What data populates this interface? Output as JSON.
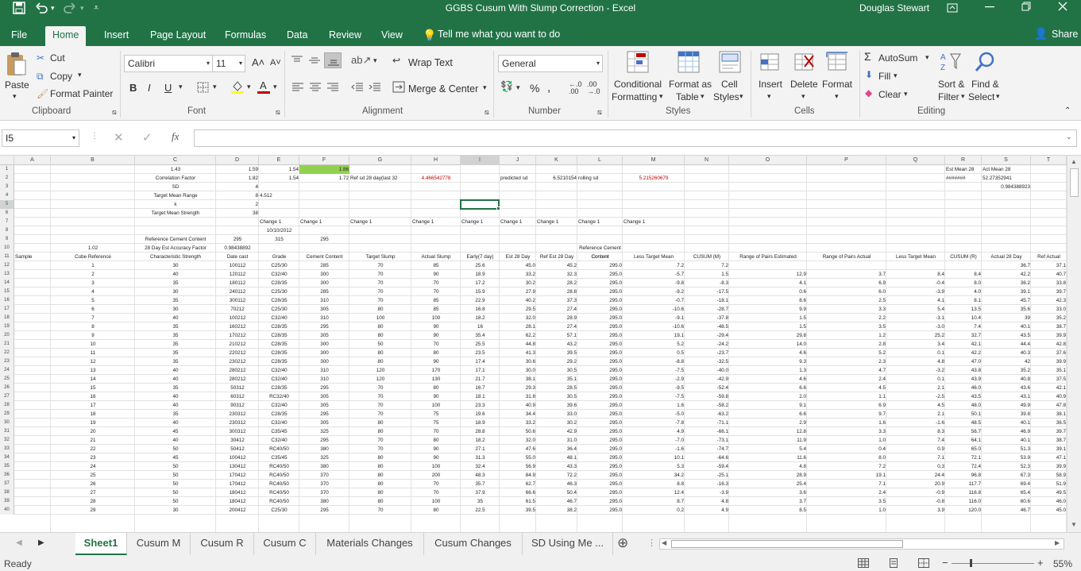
{
  "window": {
    "title": "GGBS Cusum With Slump Correction  -  Excel",
    "user": "Douglas Stewart"
  },
  "colors": {
    "brand": "#217346",
    "selected_fill": "#92d050",
    "red_text": "#c00000"
  },
  "ribbon_tabs": [
    "File",
    "Home",
    "Insert",
    "Page Layout",
    "Formulas",
    "Data",
    "Review",
    "View"
  ],
  "tell_me": "Tell me what you want to do",
  "share": "Share",
  "clipboard": {
    "paste": "Paste",
    "cut": "Cut",
    "copy": "Copy",
    "format_painter": "Format Painter",
    "label": "Clipboard"
  },
  "font": {
    "name": "Calibri",
    "size": "11",
    "label": "Font",
    "bold": "B",
    "italic": "I",
    "underline": "U"
  },
  "alignment": {
    "wrap": "Wrap Text",
    "merge": "Merge & Center",
    "label": "Alignment"
  },
  "number": {
    "format": "General",
    "label": "Number",
    "pct": "%"
  },
  "styles": {
    "cond1": "Conditional",
    "cond2": "Formatting",
    "fmt1": "Format as",
    "fmt2": "Table",
    "cell1": "Cell",
    "cell2": "Styles",
    "label": "Styles"
  },
  "cells": {
    "insert": "Insert",
    "delete": "Delete",
    "format": "Format",
    "label": "Cells"
  },
  "editing": {
    "autosum": "AutoSum",
    "fill": "Fill",
    "clear": "Clear",
    "sort1": "Sort &",
    "sort2": "Filter",
    "find1": "Find &",
    "find2": "Select",
    "label": "Editing"
  },
  "formula_bar": {
    "name_box": "I5",
    "fx": "fx",
    "value": ""
  },
  "columns": [
    "A",
    "B",
    "C",
    "D",
    "E",
    "F",
    "G",
    "H",
    "I",
    "J",
    "K",
    "L",
    "M",
    "N",
    "O",
    "P",
    "Q",
    "R",
    "S",
    "T"
  ],
  "top_rows": [
    {
      "n": "1",
      "cells": {
        "C": "1.43",
        "D": "1.59",
        "E": "1.54",
        "F": "1.86",
        "R": "Est Mean 28",
        "S": "Act Mean 28"
      }
    },
    {
      "n": "2",
      "cells": {
        "C": "Correlation Factor",
        "D": "1.82",
        "E": "1.54",
        "F": "1.72",
        "G": "Ref sd 28 day(last 32",
        "H": "4.466542778",
        "J": "predicted sd",
        "K": "6.5210154",
        "L": "rolling sd",
        "M": "5.215260679",
        "R": "#######",
        "S": "52.27352941"
      }
    },
    {
      "n": "3",
      "cells": {
        "C": "SD",
        "D": "4",
        "S": "0.984388923"
      }
    },
    {
      "n": "4",
      "cells": {
        "C": "Target Mean Range",
        "D": "8",
        "E": "4.512"
      }
    },
    {
      "n": "5",
      "cells": {
        "C": "k",
        "D": "2"
      }
    },
    {
      "n": "6",
      "cells": {
        "C": "Target Mean Strength",
        "D": "38"
      }
    },
    {
      "n": "7",
      "cells": {
        "E": "Change 1",
        "F": "Change 1",
        "G": "Change 1",
        "H": "Change 1",
        "I": "Change 1",
        "J": "Change 1",
        "K": "Change 1",
        "L": "Change 1",
        "M": "Change 1"
      }
    },
    {
      "n": "8",
      "cells": {
        "E": "10/10/2012"
      }
    },
    {
      "n": "9",
      "cells": {
        "C": "Reference Cement Content",
        "D": "295",
        "E": "315",
        "F": "295"
      }
    },
    {
      "n": "10",
      "cells": {
        "B": "1.02",
        "C": "28 Day Est Accuracy Factor",
        "D": "0.98438892",
        "L": "Reference Cement Content"
      }
    },
    {
      "n": "11",
      "cells": {
        "A": "Sample",
        "B": "Cube Reference",
        "C": "Characteristic Strength",
        "D": "Date cast",
        "E": "Grade",
        "F": "Cement Content",
        "G": "Target Slump",
        "H": "Actual Slump",
        "I": "Early(7 day)",
        "J": "Est 28 Day",
        "K": "Ref Est 28 Day",
        "L": "Content",
        "M": "Less Target Mean",
        "N": "CUSUM (M)",
        "O": "Range of Pairs Estimated",
        "P": "Range of Pairs Actual",
        "Q": "Less Target Mean",
        "R": "CUSUM (R)",
        "S": "Actual 28 Day",
        "T": "Ref Actual"
      }
    }
  ],
  "data_rows": [
    [
      "12",
      "1",
      "30",
      "100112",
      "C25/30",
      "285",
      "70",
      "85",
      "25.6",
      "45.0",
      "45.2",
      "295.0",
      "7.2",
      "7.2",
      "",
      "",
      "",
      "",
      "36.7",
      "37.1"
    ],
    [
      "13",
      "2",
      "40",
      "120112",
      "C32/40",
      "300",
      "70",
      "90",
      "18.9",
      "33.2",
      "32.3",
      "295.0",
      "-5.7",
      "1.5",
      "12.9",
      "3.7",
      "8.4",
      "8.4",
      "42.2",
      "40.7"
    ],
    [
      "14",
      "3",
      "35",
      "180112",
      "C28/35",
      "300",
      "70",
      "70",
      "17.2",
      "30.2",
      "28.2",
      "295.0",
      "-9.8",
      "-8.3",
      "4.1",
      "6.9",
      "-0.4",
      "8.0",
      "36.2",
      "33.8"
    ],
    [
      "15",
      "4",
      "30",
      "240112",
      "C25/30",
      "285",
      "70",
      "70",
      "15.9",
      "27.9",
      "28.8",
      "295.0",
      "-9.2",
      "-17.5",
      "0.6",
      "6.0",
      "-3.9",
      "4.0",
      "39.1",
      "39.7"
    ],
    [
      "16",
      "5",
      "35",
      "300112",
      "C28/35",
      "310",
      "70",
      "85",
      "22.9",
      "40.2",
      "37.3",
      "295.0",
      "-0.7",
      "-18.1",
      "8.6",
      "2.5",
      "4.1",
      "8.1",
      "45.7",
      "42.3"
    ],
    [
      "17",
      "6",
      "30",
      "70212",
      "C25/30",
      "305",
      "80",
      "85",
      "16.8",
      "29.5",
      "27.4",
      "295.0",
      "-10.6",
      "-28.7",
      "9.9",
      "3.3",
      "5.4",
      "13.5",
      "35.6",
      "33.0"
    ],
    [
      "18",
      "7",
      "40",
      "100212",
      "C32/40",
      "310",
      "100",
      "100",
      "18.2",
      "32.0",
      "28.9",
      "295.0",
      "-9.1",
      "-37.8",
      "1.5",
      "2.2",
      "-3.1",
      "10.4",
      "39",
      "35.2"
    ],
    [
      "19",
      "8",
      "35",
      "160212",
      "C28/35",
      "295",
      "80",
      "90",
      "16",
      "28.1",
      "27.4",
      "295.0",
      "-10.6",
      "-48.5",
      "1.5",
      "3.5",
      "-3.0",
      "7.4",
      "40.1",
      "38.7"
    ],
    [
      "20",
      "9",
      "35",
      "170212",
      "C28/35",
      "305",
      "80",
      "90",
      "35.4",
      "62.2",
      "57.1",
      "295.0",
      "19.1",
      "-29.4",
      "29.8",
      "1.2",
      "25.2",
      "32.7",
      "43.5",
      "39.9"
    ],
    [
      "21",
      "10",
      "35",
      "210212",
      "C28/35",
      "300",
      "50",
      "70",
      "25.5",
      "44.8",
      "43.2",
      "295.0",
      "5.2",
      "-24.2",
      "14.0",
      "2.8",
      "3.4",
      "42.1",
      "44.4",
      "42.8"
    ],
    [
      "22",
      "11",
      "35",
      "220212",
      "C28/35",
      "300",
      "80",
      "80",
      "23.5",
      "41.3",
      "39.5",
      "295.0",
      "0.5",
      "-23.7",
      "4.6",
      "5.2",
      "0.1",
      "42.2",
      "40.3",
      "37.6"
    ],
    [
      "23",
      "12",
      "35",
      "230212",
      "C28/35",
      "300",
      "80",
      "90",
      "17.4",
      "30.6",
      "29.2",
      "295.0",
      "-8.8",
      "-32.5",
      "9.3",
      "2.3",
      "4.8",
      "47.0",
      "42",
      "39.9"
    ],
    [
      "24",
      "13",
      "40",
      "280212",
      "C32/40",
      "310",
      "120",
      "170",
      "17.1",
      "30.0",
      "30.5",
      "295.0",
      "-7.5",
      "-40.0",
      "1.3",
      "4.7",
      "-3.2",
      "43.8",
      "35.2",
      "35.1"
    ],
    [
      "25",
      "14",
      "40",
      "280212",
      "C32/40",
      "310",
      "120",
      "130",
      "21.7",
      "38.1",
      "35.1",
      "295.0",
      "-2.9",
      "-42.9",
      "4.6",
      "2.4",
      "0.1",
      "43.9",
      "40.8",
      "37.5"
    ],
    [
      "26",
      "15",
      "35",
      "50312",
      "C28/35",
      "295",
      "70",
      "80",
      "16.7",
      "29.3",
      "28.5",
      "295.0",
      "-9.5",
      "-52.4",
      "6.6",
      "4.5",
      "2.1",
      "46.0",
      "43.6",
      "42.1"
    ],
    [
      "27",
      "16",
      "40",
      "60312",
      "RC32/40",
      "305",
      "70",
      "90",
      "18.1",
      "31.8",
      "30.5",
      "295.0",
      "-7.5",
      "-59.8",
      "2.0",
      "1.1",
      "-2.5",
      "43.5",
      "43.1",
      "40.9"
    ],
    [
      "28",
      "17",
      "40",
      "90312",
      "C32/40",
      "305",
      "70",
      "100",
      "23.3",
      "40.9",
      "39.6",
      "295.0",
      "1.6",
      "-58.2",
      "9.1",
      "6.9",
      "4.5",
      "48.0",
      "49.9",
      "47.8"
    ],
    [
      "29",
      "18",
      "35",
      "230312",
      "C28/35",
      "295",
      "70",
      "75",
      "19.6",
      "34.4",
      "33.0",
      "295.0",
      "-5.0",
      "-63.2",
      "6.6",
      "9.7",
      "2.1",
      "50.1",
      "39.8",
      "38.1"
    ],
    [
      "30",
      "19",
      "40",
      "230312",
      "C32/40",
      "305",
      "80",
      "75",
      "18.9",
      "33.2",
      "30.2",
      "295.0",
      "-7.8",
      "-71.1",
      "2.9",
      "1.6",
      "-1.6",
      "48.5",
      "40.1",
      "36.5"
    ],
    [
      "31",
      "20",
      "45",
      "300312",
      "C35/45",
      "325",
      "80",
      "70",
      "28.8",
      "50.6",
      "42.9",
      "295.0",
      "4.9",
      "-66.1",
      "12.8",
      "3.3",
      "8.3",
      "56.7",
      "46.9",
      "39.7"
    ],
    [
      "32",
      "21",
      "40",
      "30412",
      "C32/40",
      "295",
      "70",
      "80",
      "18.2",
      "32.0",
      "31.0",
      "295.0",
      "-7.0",
      "-73.1",
      "11.9",
      "1.0",
      "7.4",
      "64.1",
      "40.1",
      "38.7"
    ],
    [
      "33",
      "22",
      "50",
      "50412",
      "RC40/50",
      "380",
      "70",
      "90",
      "27.1",
      "47.6",
      "36.4",
      "295.0",
      "-1.6",
      "-74.7",
      "5.4",
      "0.4",
      "0.9",
      "65.0",
      "51.3",
      "39.1"
    ],
    [
      "34",
      "23",
      "45",
      "100412",
      "C35/45",
      "325",
      "80",
      "90",
      "31.3",
      "55.0",
      "48.1",
      "295.0",
      "10.1",
      "-64.6",
      "11.6",
      "8.0",
      "7.1",
      "72.1",
      "53.9",
      "47.1"
    ],
    [
      "35",
      "24",
      "50",
      "130412",
      "RC40/50",
      "380",
      "80",
      "100",
      "32.4",
      "56.9",
      "43.3",
      "295.0",
      "5.3",
      "-59.4",
      "4.8",
      "7.2",
      "0.3",
      "72.4",
      "52.3",
      "39.9"
    ],
    [
      "36",
      "25",
      "50",
      "170412",
      "RC40/50",
      "370",
      "80",
      "200",
      "48.3",
      "84.9",
      "72.2",
      "295.0",
      "34.2",
      "-25.1",
      "28.9",
      "19.1",
      "24.4",
      "96.8",
      "67.3",
      "58.9"
    ],
    [
      "37",
      "26",
      "50",
      "170412",
      "RC40/50",
      "370",
      "80",
      "70",
      "35.7",
      "62.7",
      "46.3",
      "295.0",
      "8.8",
      "-16.3",
      "25.4",
      "7.1",
      "20.9",
      "117.7",
      "69.4",
      "51.9"
    ],
    [
      "38",
      "27",
      "50",
      "180412",
      "RC40/50",
      "370",
      "80",
      "70",
      "37.9",
      "66.6",
      "50.4",
      "295.0",
      "12.4",
      "-3.9",
      "3.6",
      "2.4",
      "-0.9",
      "116.8",
      "65.4",
      "49.5"
    ],
    [
      "39",
      "28",
      "50",
      "180412",
      "RC40/50",
      "380",
      "80",
      "100",
      "35",
      "61.5",
      "46.7",
      "295.0",
      "8.7",
      "4.8",
      "3.7",
      "3.5",
      "-0.8",
      "116.0",
      "60.6",
      "46.0"
    ],
    [
      "40",
      "29",
      "30",
      "200412",
      "C25/30",
      "295",
      "70",
      "80",
      "22.5",
      "39.5",
      "38.2",
      "295.0",
      "0.2",
      "4.9",
      "8.5",
      "1.0",
      "3.9",
      "120.0",
      "46.7",
      "45.0"
    ]
  ],
  "sheet_tabs": [
    "Sheet1",
    "Cusum M",
    "Cusum R",
    "Cusum C",
    "Materials Changes",
    "Cusum Changes",
    "SD Using Me ..."
  ],
  "status": {
    "ready": "Ready",
    "zoom": "55%"
  }
}
